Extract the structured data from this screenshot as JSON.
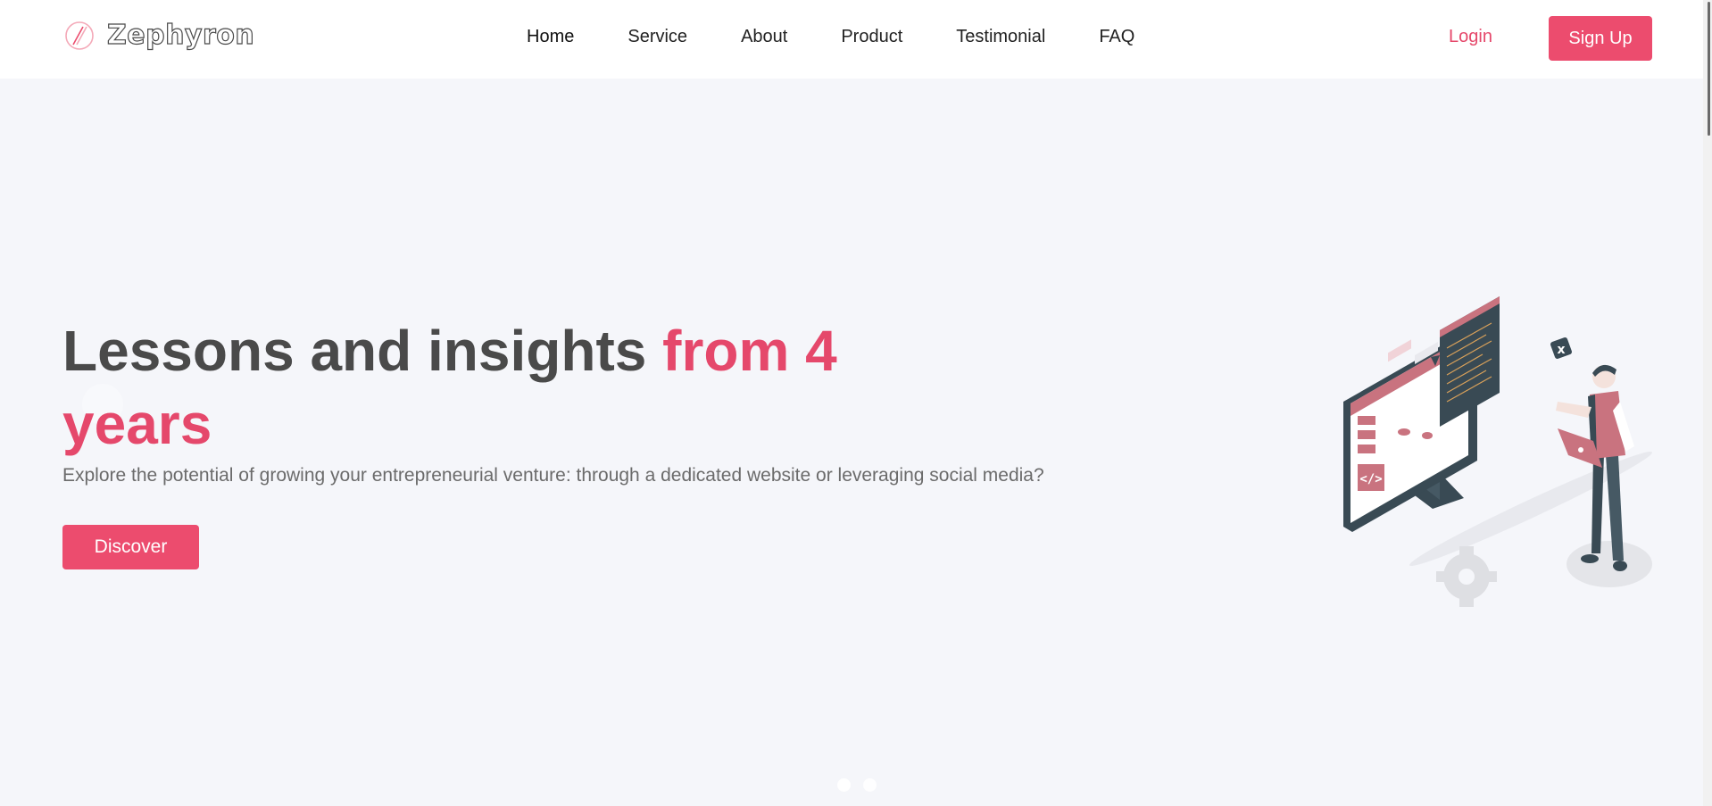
{
  "brand": {
    "name": "Zephyron",
    "logo_icon": "slash-circle-icon",
    "accent": "#ec4c6e"
  },
  "nav": {
    "items": [
      {
        "label": "Home",
        "active": true
      },
      {
        "label": "Service",
        "active": false
      },
      {
        "label": "About",
        "active": false
      },
      {
        "label": "Product",
        "active": false
      },
      {
        "label": "Testimonial",
        "active": false
      },
      {
        "label": "FAQ",
        "active": false
      }
    ],
    "login_label": "Login",
    "signup_label": "Sign Up"
  },
  "hero": {
    "title_plain": "Lessons and insights ",
    "title_accent": "from 4 years",
    "subtitle": "Explore the potential of growing your entrepreneurial venture: through a dedicated website or leveraging social media?",
    "cta_label": "Discover",
    "illustration_icon": "developer-at-computer-illustration"
  },
  "carousel": {
    "slides": 2,
    "active_slide": 1
  },
  "colors": {
    "accent": "#ec4c6e",
    "text": "#4a4a4a",
    "background": "#f5f6fa"
  }
}
